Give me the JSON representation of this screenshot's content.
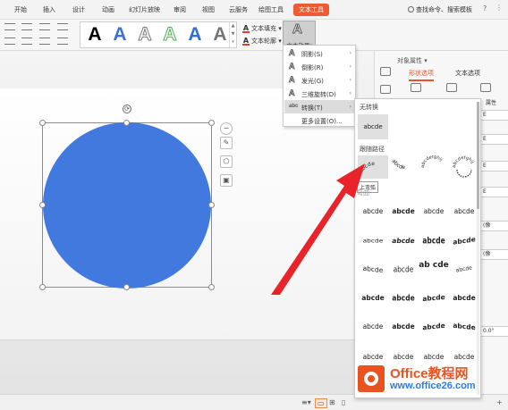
{
  "menubar": {
    "tabs": [
      "开始",
      "插入",
      "设计",
      "动画",
      "幻灯片放映",
      "审阅",
      "视图",
      "云服务",
      "绘图工具",
      "文本工具"
    ],
    "active_tab": "文本工具",
    "search": "查找命令、搜索模板",
    "help": "?",
    "more": "⋮"
  },
  "ribbon": {
    "style_glyph": "A",
    "text_fill": "文本填充",
    "text_outline": "文本轮廓",
    "text_effects": "文本效果",
    "dropdown_arrow": "▾"
  },
  "effects_menu": {
    "items": [
      {
        "label": "阴影(S)",
        "icon": "A",
        "arrow": "›"
      },
      {
        "label": "倒影(R)",
        "icon": "A",
        "arrow": "›"
      },
      {
        "label": "发光(G)",
        "icon": "A",
        "arrow": "›"
      },
      {
        "label": "三维旋转(D)",
        "icon": "A",
        "arrow": "›"
      },
      {
        "label": "转换(T)",
        "icon": "abc",
        "arrow": "›"
      },
      {
        "label": "更多设置(O)...",
        "icon": "",
        "arrow": ""
      }
    ],
    "highlighted": "转换(T)"
  },
  "transform_submenu": {
    "no_transform_title": "无转换",
    "no_transform_sample": "abcde",
    "follow_path_title": "跟随路径",
    "path_samples": [
      "abcde",
      "abcde",
      "abcdefghij",
      "abcdefghij"
    ],
    "tooltip": "上弯弧",
    "warp_title": "弯曲",
    "warp_rows": [
      [
        "abcde",
        "abcde",
        "abcde",
        "abcde"
      ],
      [
        "abcde",
        "abcde",
        "abcde",
        "abcde"
      ],
      [
        "abcde",
        "abcde",
        "ab cde",
        "abcde"
      ],
      [
        "abcde",
        "abcde",
        "abcde",
        "abcde"
      ],
      [
        "abcde",
        "abcde",
        "abcde",
        "abcde"
      ],
      [
        "abcde",
        "abcde",
        "abcde",
        "abcde"
      ]
    ]
  },
  "right_pane": {
    "title": "对象属性",
    "tab_shape": "形状选项",
    "tab_text": "文本选项",
    "field_values": [
      "E",
      "E",
      "E",
      "E",
      "E",
      "0.0°"
    ],
    "labels": [
      "属性",
      "(像",
      "(像"
    ]
  },
  "status": {
    "plus": "+"
  },
  "watermark": {
    "brand": "Office教程网",
    "url": "www.office26.com"
  },
  "colors": {
    "accent": "#f05a30",
    "shape_fill": "#4279df",
    "arrow": "#e8242a",
    "watermark_orange": "#e9541e",
    "watermark_blue": "#2b7de0"
  }
}
